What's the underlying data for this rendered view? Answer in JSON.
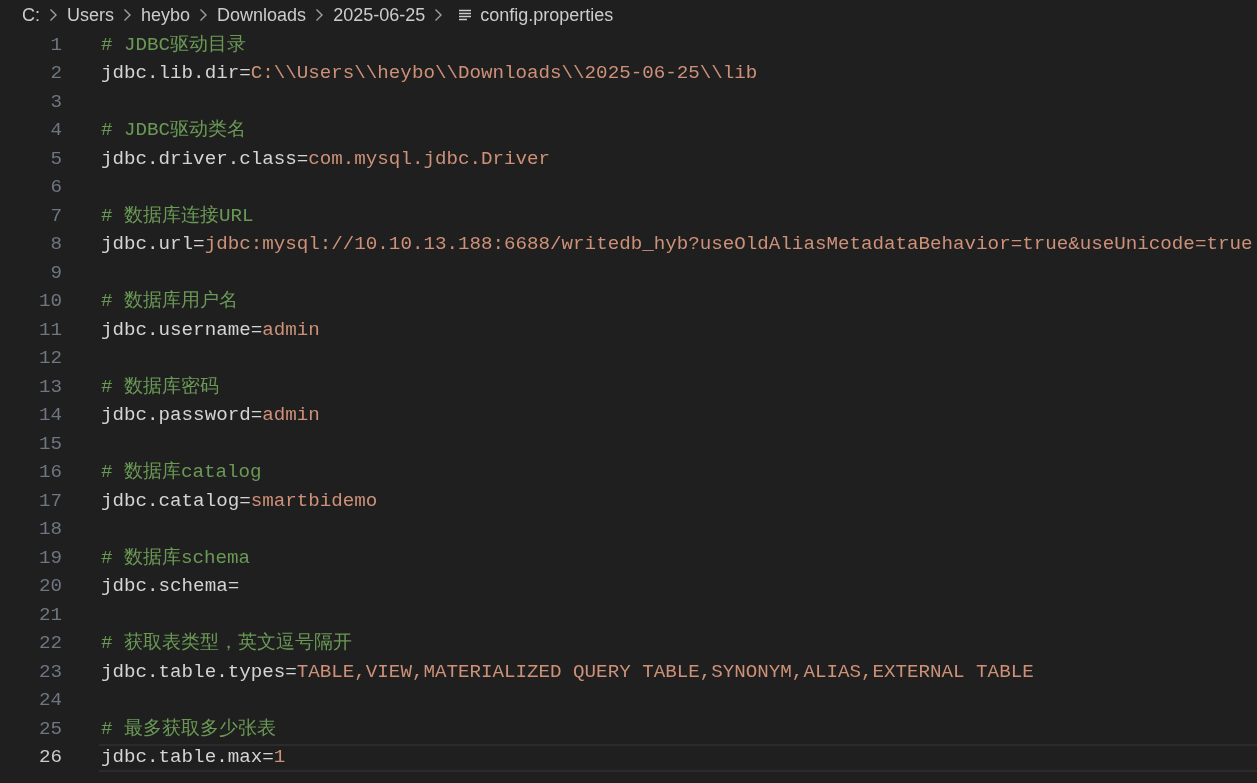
{
  "breadcrumb": {
    "segments": [
      "C:",
      "Users",
      "heybo",
      "Downloads",
      "2025-06-25"
    ],
    "file": "config.properties"
  },
  "lines": [
    {
      "number": "1",
      "kind": "comment",
      "text": "# JDBC驱动目录",
      "selected": false
    },
    {
      "number": "2",
      "kind": "property",
      "key": "jdbc.lib.dir=",
      "value": "C:\\\\Users\\\\heybo\\\\Downloads\\\\2025-06-25\\\\lib",
      "selected": false
    },
    {
      "number": "3",
      "kind": "blank",
      "selected": false
    },
    {
      "number": "4",
      "kind": "comment",
      "text": "# JDBC驱动类名",
      "selected": false
    },
    {
      "number": "5",
      "kind": "property",
      "key": "jdbc.driver.class=",
      "value": "com.mysql.jdbc.Driver",
      "selected": false
    },
    {
      "number": "6",
      "kind": "blank",
      "selected": false
    },
    {
      "number": "7",
      "kind": "comment",
      "text": "# 数据库连接URL",
      "selected": false
    },
    {
      "number": "8",
      "kind": "property",
      "key": "jdbc.url=",
      "value": "jdbc:mysql://10.10.13.188:6688/writedb_hyb?useOldAliasMetadataBehavior=true&useUnicode=true",
      "selected": false
    },
    {
      "number": "9",
      "kind": "blank",
      "selected": false
    },
    {
      "number": "10",
      "kind": "comment",
      "text": "# 数据库用户名",
      "selected": false
    },
    {
      "number": "11",
      "kind": "property",
      "key": "jdbc.username=",
      "value": "admin",
      "selected": false
    },
    {
      "number": "12",
      "kind": "blank",
      "selected": false
    },
    {
      "number": "13",
      "kind": "comment",
      "text": "# 数据库密码",
      "selected": false
    },
    {
      "number": "14",
      "kind": "property",
      "key": "jdbc.password=",
      "value": "admin",
      "selected": false
    },
    {
      "number": "15",
      "kind": "blank",
      "selected": false
    },
    {
      "number": "16",
      "kind": "comment",
      "text": "# 数据库catalog",
      "selected": false
    },
    {
      "number": "17",
      "kind": "property",
      "key": "jdbc.catalog=",
      "value": "smartbidemo",
      "selected": false
    },
    {
      "number": "18",
      "kind": "blank",
      "selected": false
    },
    {
      "number": "19",
      "kind": "comment",
      "text": "# 数据库schema",
      "selected": false
    },
    {
      "number": "20",
      "kind": "property",
      "key": "jdbc.schema=",
      "selected": false
    },
    {
      "number": "21",
      "kind": "blank",
      "selected": false
    },
    {
      "number": "22",
      "kind": "comment",
      "text": "# 获取表类型，英文逗号隔开",
      "selected": false
    },
    {
      "number": "23",
      "kind": "property",
      "key": "jdbc.table.types=",
      "value": "TABLE,VIEW,MATERIALIZED QUERY TABLE,SYNONYM,ALIAS,EXTERNAL TABLE",
      "selected": false
    },
    {
      "number": "24",
      "kind": "blank",
      "selected": false
    },
    {
      "number": "25",
      "kind": "comment",
      "text": "# 最多获取多少张表",
      "selected": false
    },
    {
      "number": "26",
      "kind": "property",
      "key": "jdbc.table.max=",
      "value": "1",
      "selected": true
    }
  ]
}
